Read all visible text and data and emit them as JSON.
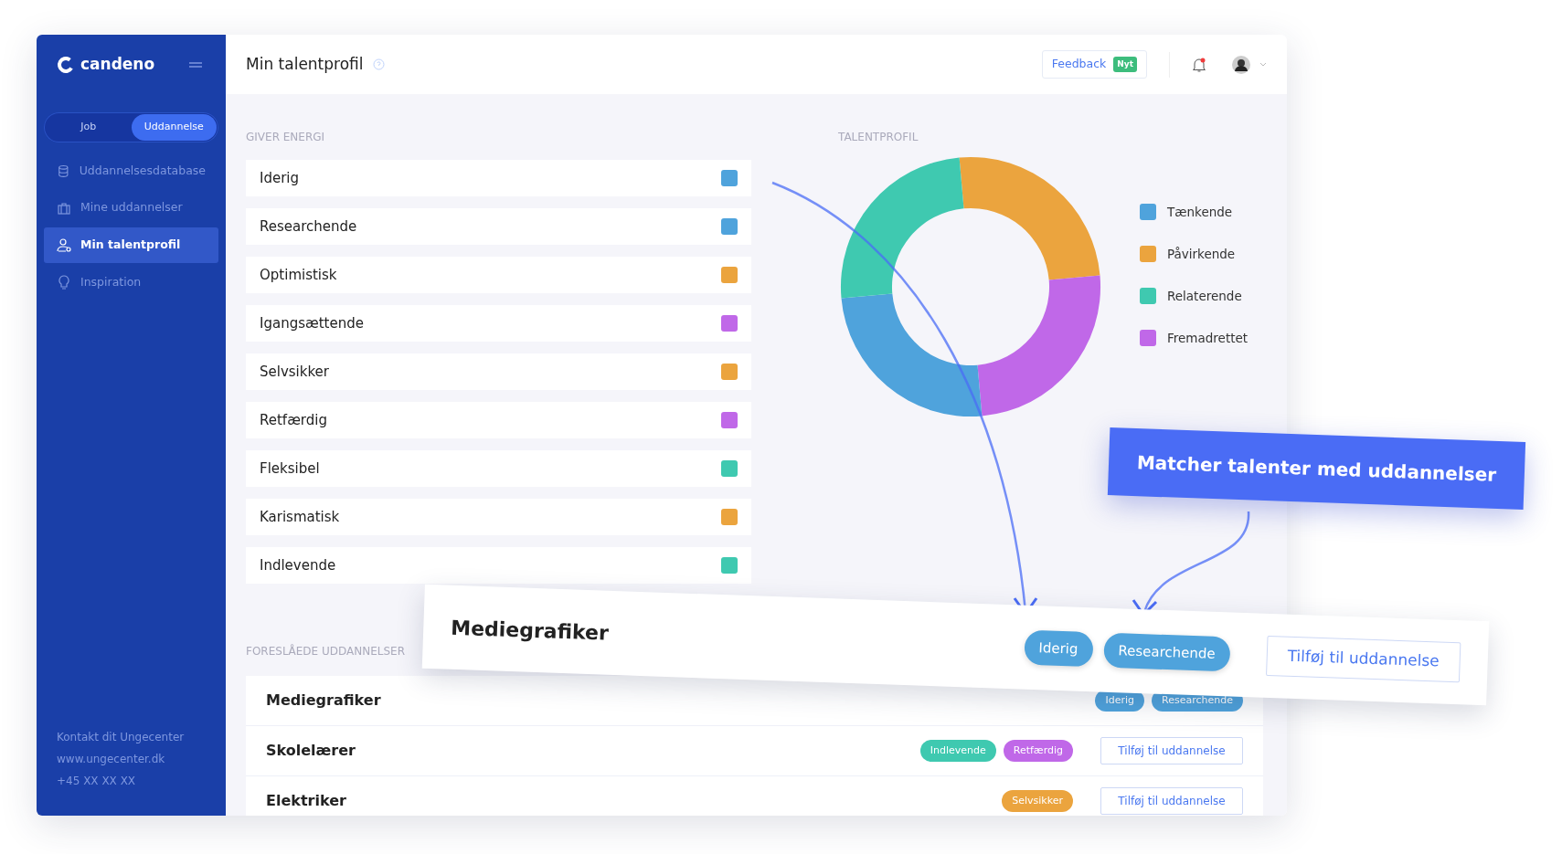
{
  "sidebar": {
    "logo": "candeno",
    "toggle": [
      {
        "label": "Job",
        "selected": false
      },
      {
        "label": "Uddannelse",
        "selected": true
      }
    ],
    "items": [
      {
        "label": "Uddannelsesdatabase",
        "selected": false
      },
      {
        "label": "Mine uddannelser",
        "selected": false
      },
      {
        "label": "Min talentprofil",
        "selected": true
      },
      {
        "label": "Inspiration",
        "selected": false
      }
    ],
    "contact": [
      "Kontakt dit Ungecenter",
      "www.ungecenter.dk",
      "+45 XX XX XX"
    ]
  },
  "header": {
    "title": "Min talentprofil",
    "feedback": "Feedback",
    "feedback_badge": "Nyt",
    "notification": true
  },
  "energy": {
    "heading": "GIVER ENERGI",
    "items": [
      {
        "label": "Iderig",
        "color": "#4fa3dc"
      },
      {
        "label": "Researchende",
        "color": "#4fa3dc"
      },
      {
        "label": "Optimistisk",
        "color": "#eba43e"
      },
      {
        "label": "Igangsættende",
        "color": "#c068e8"
      },
      {
        "label": "Selvsikker",
        "color": "#eba43e"
      },
      {
        "label": "Retfærdig",
        "color": "#c068e8"
      },
      {
        "label": "Fleksibel",
        "color": "#3fc9b0"
      },
      {
        "label": "Karismatisk",
        "color": "#eba43e"
      },
      {
        "label": "Indlevende",
        "color": "#3fc9b0"
      }
    ]
  },
  "talent": {
    "heading": "TALENTPROFIL",
    "legend": [
      {
        "label": "Tænkende",
        "color": "#4fa3dc"
      },
      {
        "label": "Påvirkende",
        "color": "#eba43e"
      },
      {
        "label": "Relaterende",
        "color": "#3fc9b0"
      },
      {
        "label": "Fremadrettet",
        "color": "#c068e8"
      }
    ]
  },
  "suggested": {
    "heading": "FORESLÅEDE UDDANNELSER",
    "rows": [
      {
        "name": "Mediegrafiker",
        "tags": [
          {
            "label": "Iderig",
            "color": "#4fa3dc"
          },
          {
            "label": "Researchende",
            "color": "#4fa3dc"
          }
        ]
      },
      {
        "name": "Skolelærer",
        "tags": [
          {
            "label": "Indlevende",
            "color": "#3fc9b0"
          },
          {
            "label": "Retfærdig",
            "color": "#c068e8"
          }
        ],
        "button": "Tilføj til uddannelse"
      },
      {
        "name": "Elektriker",
        "tags": [
          {
            "label": "Selvsikker",
            "color": "#eba43e"
          }
        ],
        "button": "Tilføj til uddannelse"
      }
    ]
  },
  "overlay_card": {
    "name": "Mediegrafiker",
    "tags": [
      {
        "label": "Iderig",
        "color": "#4fa3dc"
      },
      {
        "label": "Researchende",
        "color": "#4fa3dc"
      }
    ],
    "button": "Tilføj til uddannelse"
  },
  "banner": {
    "text": "Matcher talenter med uddannelser"
  }
}
